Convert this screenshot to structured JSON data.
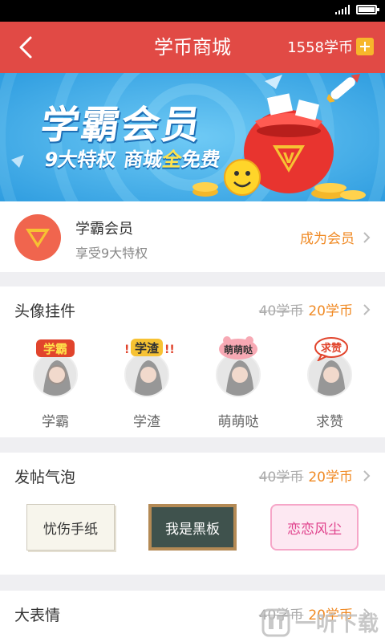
{
  "app": {
    "title": "学币商城",
    "coins_label": "1558学币"
  },
  "banner": {
    "title": "学霸会员",
    "subtitle_prefix": "9大特权",
    "subtitle_mid": "商城",
    "subtitle_free_1": "全",
    "subtitle_free_2": "免费"
  },
  "member": {
    "name": "学霸会员",
    "desc": "享受9大特权",
    "action": "成为会员"
  },
  "pendant": {
    "title": "头像挂件",
    "old_price": "40学币",
    "new_price": "20学币",
    "items": [
      {
        "label": "学霸",
        "sticker": "学霸"
      },
      {
        "label": "学渣",
        "sticker": "学渣"
      },
      {
        "label": "萌萌哒",
        "sticker": "萌萌哒"
      },
      {
        "label": "求赞",
        "sticker": "求赞"
      }
    ]
  },
  "bubble": {
    "title": "发帖气泡",
    "old_price": "40学币",
    "new_price": "20学币",
    "items": [
      {
        "label": "忧伤手纸"
      },
      {
        "label": "我是黑板"
      },
      {
        "label": "恋恋风尘"
      }
    ]
  },
  "emoji": {
    "title": "大表情",
    "old_price": "40学币",
    "new_price": "20学币"
  },
  "watermark": {
    "text": "一听下载"
  },
  "colors": {
    "primary_red": "#e14a45",
    "accent_orange": "#f08a24",
    "banner_blue": "#49b7ee"
  }
}
